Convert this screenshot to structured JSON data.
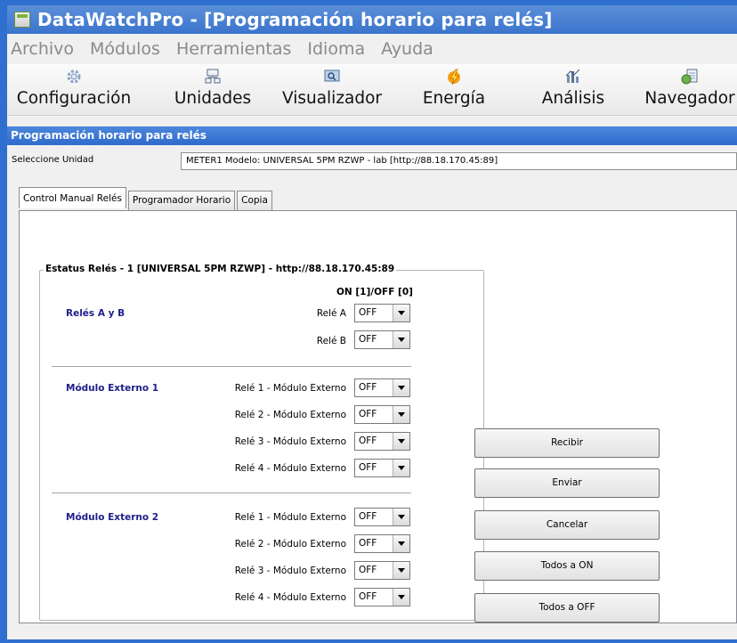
{
  "window": {
    "title": "DataWatchPro - [Programación horario para relés]"
  },
  "menu": [
    "Archivo",
    "Módulos",
    "Herramientas",
    "Idioma",
    "Ayuda"
  ],
  "toolbar": [
    {
      "label": "Configuración",
      "icon": "gear-icon"
    },
    {
      "label": "Unidades",
      "icon": "network-icon"
    },
    {
      "label": "Visualizador",
      "icon": "monitor-icon"
    },
    {
      "label": "Energía",
      "icon": "lightning-icon"
    },
    {
      "label": "Análisis",
      "icon": "analysis-icon"
    },
    {
      "label": "Navegador",
      "icon": "browser-icon"
    }
  ],
  "panel": {
    "title": "Programación horario para relés"
  },
  "unit": {
    "label": "Seleccione Unidad",
    "value": "METER1  Modelo: UNIVERSAL 5PM RZWP - lab [http://88.18.170.45:89]"
  },
  "tabs": [
    "Control Manual Relés",
    "Programador Horario",
    "Copia"
  ],
  "status": {
    "legend": "Estatus Relés - 1 [UNIVERSAL 5PM RZWP] - http://88.18.170.45:89",
    "onoff_header": "ON [1]/OFF [0]",
    "groups": [
      {
        "name": "Relés A y B",
        "relays": [
          {
            "label": "Relé A",
            "value": "OFF"
          },
          {
            "label": "Relé B",
            "value": "OFF"
          }
        ]
      },
      {
        "name": "Módulo Externo 1",
        "relays": [
          {
            "label": "Relé 1 - Módulo Externo",
            "value": "OFF"
          },
          {
            "label": "Relé 2 - Módulo Externo",
            "value": "OFF"
          },
          {
            "label": "Relé 3 - Módulo Externo",
            "value": "OFF"
          },
          {
            "label": "Relé 4 - Módulo Externo",
            "value": "OFF"
          }
        ]
      },
      {
        "name": "Módulo Externo 2",
        "relays": [
          {
            "label": "Relé 1 - Módulo Externo",
            "value": "OFF"
          },
          {
            "label": "Relé 2 - Módulo Externo",
            "value": "OFF"
          },
          {
            "label": "Relé 3 - Módulo Externo",
            "value": "OFF"
          },
          {
            "label": "Relé 4 - Módulo Externo",
            "value": "OFF"
          }
        ]
      }
    ]
  },
  "buttons": {
    "recibir": "Recibir",
    "enviar": "Enviar",
    "cancelar": "Cancelar",
    "todos_on": "Todos a ON",
    "todos_off": "Todos a OFF"
  },
  "colors": {
    "title_bar": "#3b74cc",
    "panel_header": "#2e6bcc",
    "section_text": "#1f1f8a"
  }
}
